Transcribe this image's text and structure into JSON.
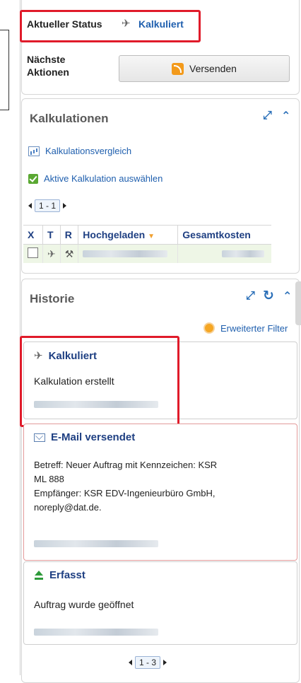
{
  "status": {
    "label": "Aktueller Status",
    "value": "Kalkuliert",
    "next_actions_label_1": "Nächste",
    "next_actions_label_2": "Aktionen",
    "send_button": "Versenden"
  },
  "kalkulationen": {
    "title": "Kalkulationen",
    "link_compare": "Kalkulationsvergleich",
    "link_select_active": "Aktive Kalkulation auswählen",
    "pager": "1 - 1",
    "columns": [
      "X",
      "T",
      "R",
      "Hochgeladen",
      "Gesamtkosten"
    ]
  },
  "historie": {
    "title": "Historie",
    "extended_filter": "Erweiterter Filter",
    "cards": [
      {
        "title": "Kalkuliert",
        "lines": [
          "Kalkulation erstellt"
        ]
      },
      {
        "title": "E-Mail versendet",
        "lines": [
          "Betreff: Neuer Auftrag mit Kennzeichen: KSR",
          "ML 888",
          "Empfänger: KSR EDV-Ingenieurbüro GmbH,",
          "noreply@dat.de."
        ]
      },
      {
        "title": "Erfasst",
        "lines": [
          "Auftrag wurde geöffnet"
        ]
      }
    ],
    "pager": "1 - 3"
  },
  "colors": {
    "highlight_red": "#e01b2a",
    "link_blue": "#1f5fae",
    "heading_navy": "#1e3f82",
    "row_green": "#eef6e6"
  }
}
